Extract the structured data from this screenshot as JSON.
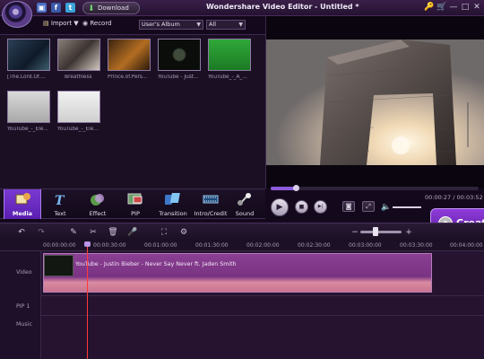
{
  "app": {
    "title": "Wondershare Video Editor - Untitled *"
  },
  "titlebar": {
    "download_label": "Download",
    "controls": [
      "🔑",
      "🛒",
      "—",
      "□",
      "✕"
    ]
  },
  "library": {
    "import_label": "Import ▼",
    "record_label": "Record",
    "album_select": "User's Album",
    "filter_select": "All",
    "items": [
      {
        "label": "[The.Lord.Of....",
        "kind": "video"
      },
      {
        "label": "Breathless",
        "kind": "video"
      },
      {
        "label": "Prince.of.Pers...",
        "kind": "video"
      },
      {
        "label": "YouTube - Just...",
        "kind": "video"
      },
      {
        "label": "YouTube_-_A_...",
        "kind": "video"
      },
      {
        "label": "YouTube_-_Ele...",
        "kind": "video"
      },
      {
        "label": "YouTube_-_Ele...",
        "kind": "video"
      }
    ]
  },
  "tabs": [
    {
      "label": "Media",
      "active": true,
      "icon": "media-icon"
    },
    {
      "label": "Text",
      "active": false,
      "icon": "text-icon"
    },
    {
      "label": "Effect",
      "active": false,
      "icon": "effect-icon"
    },
    {
      "label": "PIP",
      "active": false,
      "icon": "pip-icon"
    },
    {
      "label": "Transition",
      "active": false,
      "icon": "transition-icon"
    },
    {
      "label": "Intro/Credit",
      "active": false,
      "icon": "intro-credit-icon"
    },
    {
      "label": "Sound",
      "active": false,
      "icon": "sound-icon"
    }
  ],
  "player": {
    "time": "00:00:27 / 00:03:52",
    "progress": 0.12,
    "play_symbol": "▶",
    "stop_symbol": "■",
    "next_symbol": "▶|"
  },
  "create": {
    "label": "Create"
  },
  "timeline": {
    "ruler": [
      "00:00:00:00",
      "00:00:30:00",
      "00:01:00:00",
      "00:01:30:00",
      "00:02:00:00",
      "00:02:30:00",
      "00:03:00:00",
      "00:03:30:00",
      "00:04:00:00"
    ],
    "tracks": [
      "Video",
      "PIP 1",
      "Music"
    ],
    "clip_title": "YouTube - Justin Bieber - Never Say Never ft. Jaden Smith",
    "zoom_minus": "−",
    "zoom_plus": "+"
  }
}
